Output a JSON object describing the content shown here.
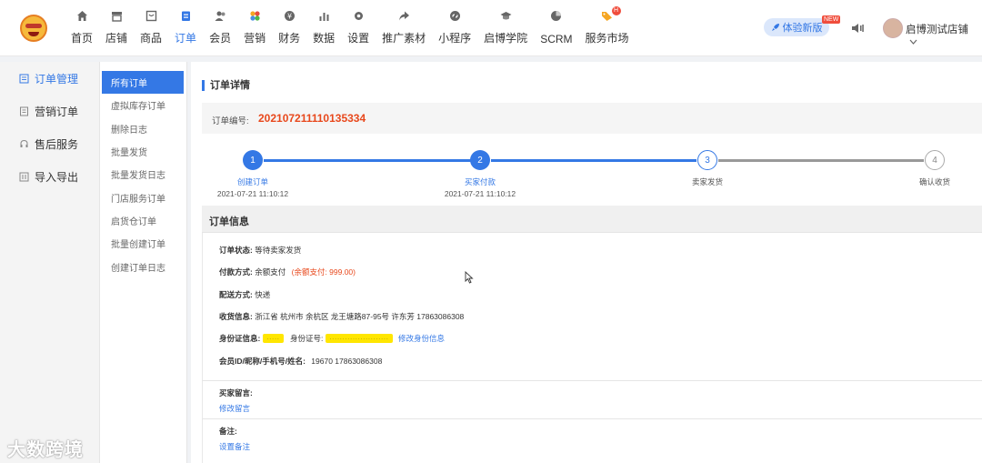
{
  "topnav": {
    "items": [
      {
        "label": "首页",
        "icon": "home-icon"
      },
      {
        "label": "店铺",
        "icon": "store-icon"
      },
      {
        "label": "商品",
        "icon": "goods-icon"
      },
      {
        "label": "订单",
        "icon": "order-icon",
        "active": true
      },
      {
        "label": "会员",
        "icon": "member-icon"
      },
      {
        "label": "营销",
        "icon": "marketing-icon"
      },
      {
        "label": "财务",
        "icon": "finance-icon"
      },
      {
        "label": "数据",
        "icon": "data-icon"
      },
      {
        "label": "设置",
        "icon": "settings-icon"
      },
      {
        "label": "推广素材",
        "icon": "share-icon"
      },
      {
        "label": "小程序",
        "icon": "miniprogram-icon"
      },
      {
        "label": "启博学院",
        "icon": "academy-icon"
      },
      {
        "label": "SCRM",
        "icon": "scrm-icon"
      },
      {
        "label": "服务市场",
        "icon": "service-market-icon",
        "badge": "H"
      }
    ],
    "try_new": "体验新版",
    "new_tag": "NEW",
    "shop_name": "启博测试店铺"
  },
  "sidebar": {
    "items": [
      {
        "label": "订单管理",
        "active": true
      },
      {
        "label": "营销订单"
      },
      {
        "label": "售后服务"
      },
      {
        "label": "导入导出"
      }
    ]
  },
  "subnav": {
    "items": [
      "所有订单",
      "虚拟库存订单",
      "删除日志",
      "批量发货",
      "批量发货日志",
      "门店服务订单",
      "启货仓订单",
      "批量创建订单",
      "创建订单日志"
    ]
  },
  "detail": {
    "title": "订单详情",
    "order_no_label": "订单编号:",
    "order_no": "202107211110135334",
    "steps": [
      {
        "num": "1",
        "label": "创建订单",
        "time": "2021-07-21 11:10:12",
        "state": "done"
      },
      {
        "num": "2",
        "label": "买家付款",
        "time": "2021-07-21 11:10:12",
        "state": "done"
      },
      {
        "num": "3",
        "label": "卖家发货",
        "time": "",
        "state": "doing"
      },
      {
        "num": "4",
        "label": "确认收货",
        "time": "",
        "state": "todo"
      }
    ],
    "info_title": "订单信息",
    "status_label": "订单状态:",
    "status_value": "等待卖家发货",
    "pay_label": "付款方式:",
    "pay_value": "余额支付",
    "pay_extra": "(余额支付: 999.00)",
    "ship_label": "配送方式:",
    "ship_value": "快递",
    "address_label": "收货信息:",
    "address_value": "浙江省 杭州市 余杭区 龙王塘路87-95号   许东芳   17863086308",
    "id_label": "身份证信息:",
    "id_number_label": "身份证号:",
    "id_edit_link": "修改身份信息",
    "member_label": "会员ID/昵称/手机号/姓名:",
    "member_value": "19670     17863086308",
    "buyer_msg_label": "买家留言:",
    "buyer_msg_link": "修改留言",
    "remark_label": "备注:",
    "remark_link": "设置备注"
  },
  "watermark": "大数跨境",
  "colors": {
    "accent": "#3478e5",
    "order_no": "#e8481c"
  }
}
